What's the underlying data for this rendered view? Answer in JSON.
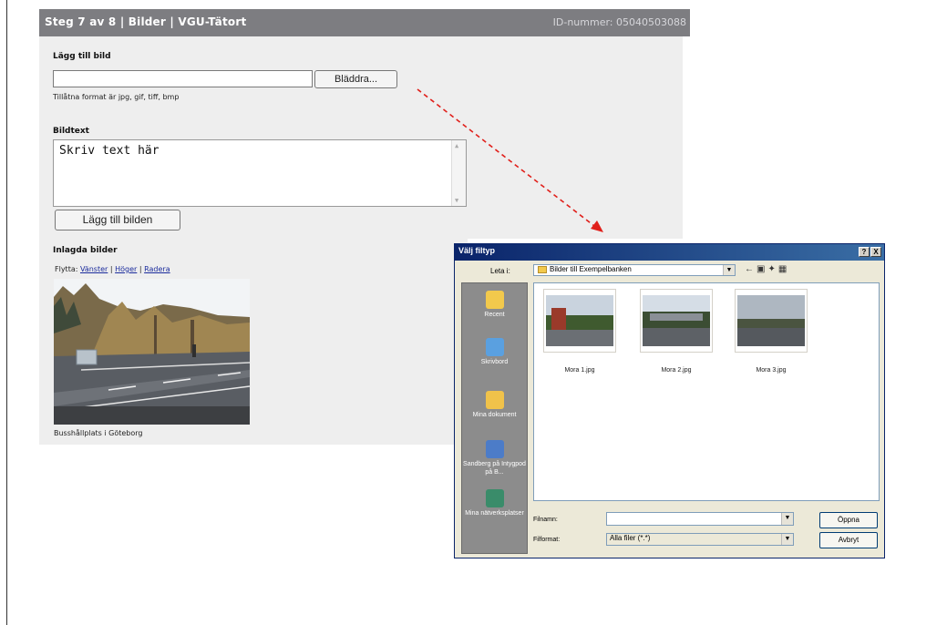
{
  "form": {
    "header_steps": "Steg 7 av 8 | Bilder | VGU-Tätort",
    "header_id": "ID-nummer: 05040503088",
    "add_image_label": "Lägg till bild",
    "browse_button": "Bläddra...",
    "allowed_formats": "Tillåtna format är jpg, gif, tiff, bmp",
    "caption_label": "Bildtext",
    "caption_value": "Skriv text här",
    "add_button": "Lägg till bilden",
    "added_images_label": "Inlagda bilder",
    "move_label": "Flytta:",
    "move_left": "Vänster",
    "move_right": "Höger",
    "delete": "Radera",
    "separator": "|",
    "image_caption": "Busshållplats i Göteborg"
  },
  "dialog": {
    "title": "Välj filtyp",
    "help_btn": "?",
    "close_btn": "X",
    "look_in_label": "Leta i:",
    "look_in_value": "Bilder till Exempelbanken",
    "places": [
      "Recent",
      "Skrivbord",
      "Mina dokument",
      "Sandberg på Intygpod på B...",
      "Mina nätverksplatser"
    ],
    "files": [
      "Mora 1.jpg",
      "Mora 2.jpg",
      "Mora 3.jpg"
    ],
    "filename_label": "Filnamn:",
    "filename_value": "",
    "filetype_label": "Filformat:",
    "filetype_value": "Alla filer (*.*)",
    "open_button": "Öppna",
    "cancel_button": "Avbryt"
  },
  "colors": {
    "header": "#7d7d81",
    "panel": "#eeeeee",
    "link": "#1a2b9c",
    "arrow": "#e0201b",
    "dialog_title": "#0a246a"
  }
}
